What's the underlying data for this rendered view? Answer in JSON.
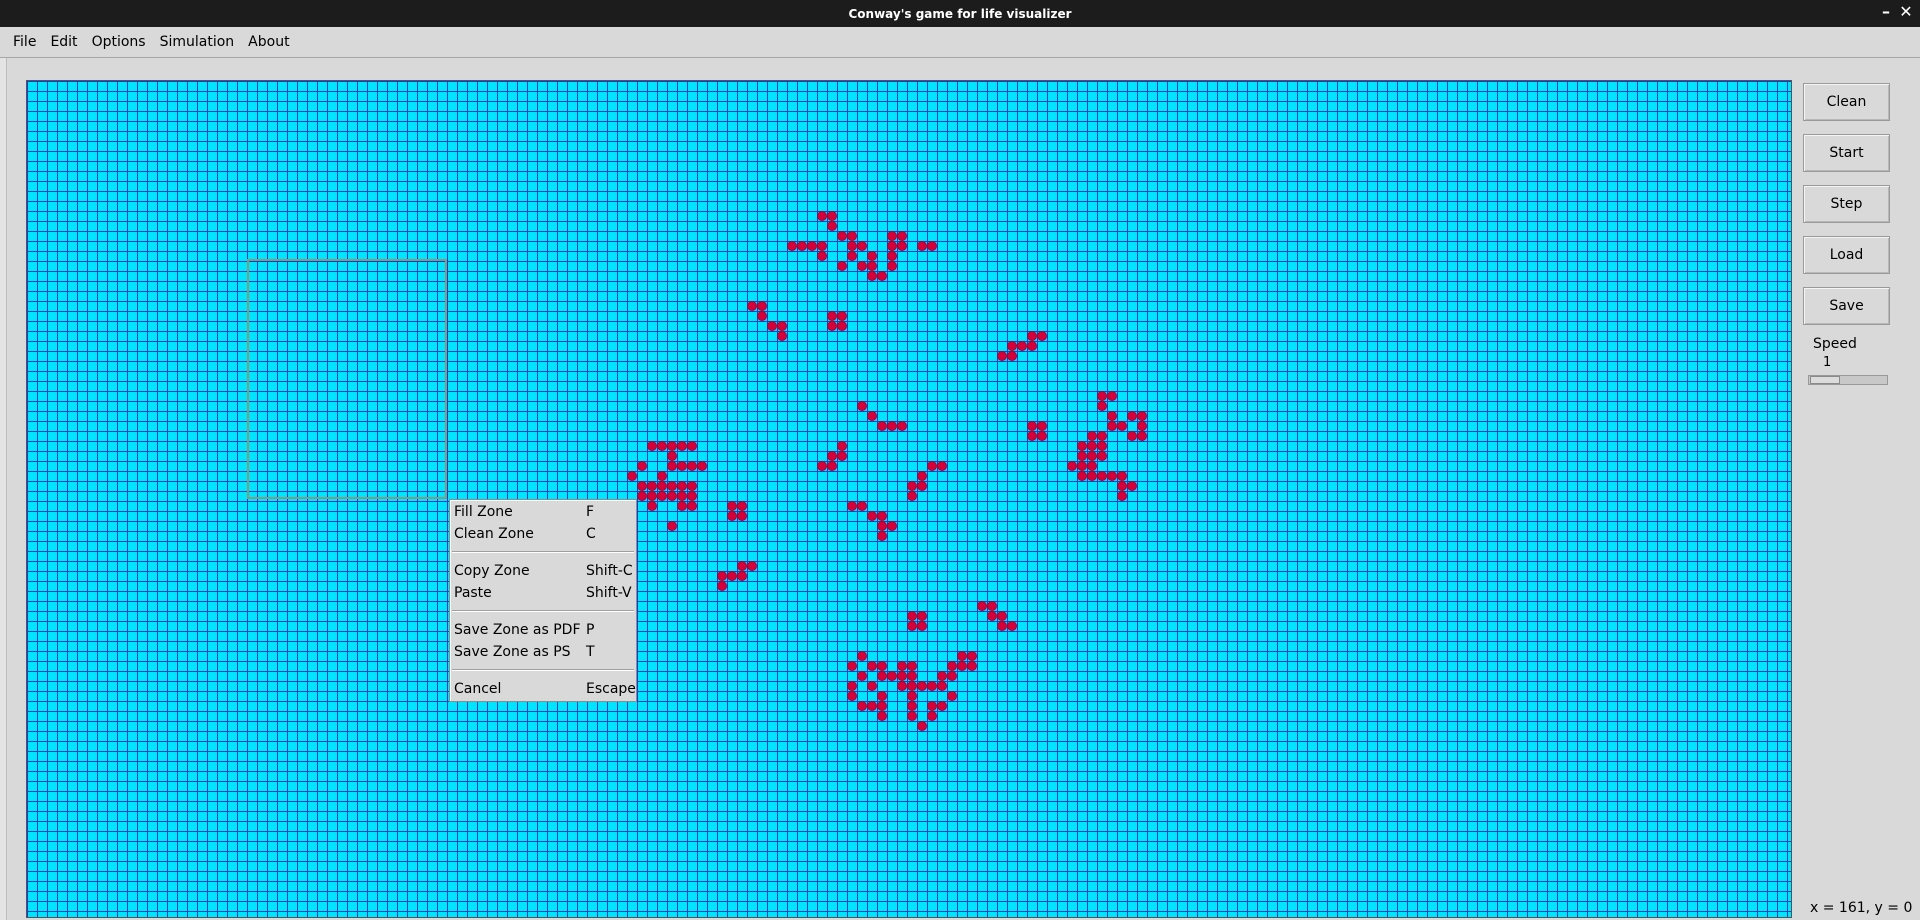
{
  "window": {
    "title": "Conway's game for life visualizer",
    "minimize_symbol": "–",
    "close_symbol": "✕"
  },
  "menubar": {
    "items": [
      "File",
      "Edit",
      "Options",
      "Simulation",
      "About"
    ]
  },
  "grid": {
    "background": "#00e5ff",
    "line_color": "#1540c8",
    "cell_color": "#d4003b",
    "live_cells": [
      [
        79,
        13
      ],
      [
        80,
        13
      ],
      [
        80,
        14
      ],
      [
        81,
        15
      ],
      [
        76,
        16
      ],
      [
        77,
        16
      ],
      [
        78,
        16
      ],
      [
        79,
        16
      ],
      [
        82,
        15
      ],
      [
        82,
        16
      ],
      [
        83,
        16
      ],
      [
        86,
        15
      ],
      [
        87,
        15
      ],
      [
        86,
        16
      ],
      [
        87,
        16
      ],
      [
        89,
        16
      ],
      [
        90,
        16
      ],
      [
        79,
        17
      ],
      [
        82,
        17
      ],
      [
        84,
        17
      ],
      [
        86,
        17
      ],
      [
        81,
        18
      ],
      [
        83,
        18
      ],
      [
        84,
        18
      ],
      [
        86,
        18
      ],
      [
        84,
        19
      ],
      [
        85,
        19
      ],
      [
        72,
        22
      ],
      [
        73,
        22
      ],
      [
        73,
        23
      ],
      [
        74,
        24
      ],
      [
        75,
        24
      ],
      [
        75,
        25
      ],
      [
        80,
        23
      ],
      [
        81,
        23
      ],
      [
        80,
        24
      ],
      [
        81,
        24
      ],
      [
        100,
        25
      ],
      [
        101,
        25
      ],
      [
        98,
        26
      ],
      [
        99,
        26
      ],
      [
        100,
        26
      ],
      [
        97,
        27
      ],
      [
        98,
        27
      ],
      [
        107,
        31
      ],
      [
        108,
        31
      ],
      [
        107,
        32
      ],
      [
        108,
        33
      ],
      [
        110,
        33
      ],
      [
        111,
        33
      ],
      [
        108,
        34
      ],
      [
        109,
        34
      ],
      [
        111,
        34
      ],
      [
        110,
        35
      ],
      [
        111,
        35
      ],
      [
        106,
        35
      ],
      [
        107,
        35
      ],
      [
        105,
        36
      ],
      [
        106,
        36
      ],
      [
        107,
        36
      ],
      [
        105,
        37
      ],
      [
        106,
        37
      ],
      [
        107,
        37
      ],
      [
        104,
        38
      ],
      [
        105,
        38
      ],
      [
        106,
        38
      ],
      [
        105,
        39
      ],
      [
        106,
        39
      ],
      [
        107,
        39
      ],
      [
        108,
        39
      ],
      [
        109,
        39
      ],
      [
        109,
        40
      ],
      [
        110,
        40
      ],
      [
        109,
        41
      ],
      [
        83,
        32
      ],
      [
        84,
        33
      ],
      [
        85,
        34
      ],
      [
        86,
        34
      ],
      [
        87,
        34
      ],
      [
        100,
        34
      ],
      [
        101,
        34
      ],
      [
        100,
        35
      ],
      [
        101,
        35
      ],
      [
        62,
        36
      ],
      [
        63,
        36
      ],
      [
        64,
        36
      ],
      [
        65,
        36
      ],
      [
        66,
        36
      ],
      [
        64,
        37
      ],
      [
        61,
        38
      ],
      [
        64,
        38
      ],
      [
        65,
        38
      ],
      [
        66,
        38
      ],
      [
        60,
        39
      ],
      [
        63,
        39
      ],
      [
        67,
        38
      ],
      [
        61,
        40
      ],
      [
        62,
        40
      ],
      [
        63,
        40
      ],
      [
        64,
        40
      ],
      [
        65,
        40
      ],
      [
        66,
        40
      ],
      [
        61,
        41
      ],
      [
        62,
        41
      ],
      [
        63,
        41
      ],
      [
        64,
        41
      ],
      [
        65,
        41
      ],
      [
        66,
        41
      ],
      [
        62,
        42
      ],
      [
        65,
        42
      ],
      [
        66,
        42
      ],
      [
        64,
        44
      ],
      [
        81,
        36
      ],
      [
        80,
        37
      ],
      [
        81,
        37
      ],
      [
        79,
        38
      ],
      [
        80,
        38
      ],
      [
        90,
        38
      ],
      [
        91,
        38
      ],
      [
        89,
        39
      ],
      [
        88,
        40
      ],
      [
        89,
        40
      ],
      [
        88,
        41
      ],
      [
        70,
        42
      ],
      [
        71,
        42
      ],
      [
        70,
        43
      ],
      [
        71,
        43
      ],
      [
        82,
        42
      ],
      [
        83,
        42
      ],
      [
        84,
        43
      ],
      [
        85,
        43
      ],
      [
        85,
        44
      ],
      [
        86,
        44
      ],
      [
        85,
        45
      ],
      [
        71,
        48
      ],
      [
        72,
        48
      ],
      [
        69,
        49
      ],
      [
        70,
        49
      ],
      [
        71,
        49
      ],
      [
        69,
        50
      ],
      [
        88,
        53
      ],
      [
        89,
        53
      ],
      [
        88,
        54
      ],
      [
        89,
        54
      ],
      [
        95,
        52
      ],
      [
        96,
        52
      ],
      [
        96,
        53
      ],
      [
        97,
        53
      ],
      [
        97,
        54
      ],
      [
        98,
        54
      ],
      [
        83,
        57
      ],
      [
        93,
        57
      ],
      [
        94,
        57
      ],
      [
        82,
        58
      ],
      [
        84,
        58
      ],
      [
        85,
        58
      ],
      [
        87,
        58
      ],
      [
        88,
        58
      ],
      [
        92,
        58
      ],
      [
        93,
        58
      ],
      [
        94,
        58
      ],
      [
        83,
        59
      ],
      [
        85,
        59
      ],
      [
        86,
        59
      ],
      [
        87,
        59
      ],
      [
        88,
        59
      ],
      [
        91,
        59
      ],
      [
        92,
        59
      ],
      [
        82,
        60
      ],
      [
        84,
        60
      ],
      [
        87,
        60
      ],
      [
        88,
        60
      ],
      [
        89,
        60
      ],
      [
        90,
        60
      ],
      [
        91,
        60
      ],
      [
        82,
        61
      ],
      [
        85,
        61
      ],
      [
        88,
        61
      ],
      [
        92,
        61
      ],
      [
        83,
        62
      ],
      [
        84,
        62
      ],
      [
        85,
        62
      ],
      [
        88,
        62
      ],
      [
        90,
        62
      ],
      [
        91,
        62
      ],
      [
        85,
        63
      ],
      [
        88,
        63
      ],
      [
        90,
        63
      ],
      [
        89,
        64
      ]
    ]
  },
  "context_menu": {
    "groups": [
      [
        {
          "label": "Fill Zone",
          "accel": "F"
        },
        {
          "label": "Clean Zone",
          "accel": "C"
        }
      ],
      [
        {
          "label": "Copy Zone",
          "accel": "Shift-C"
        },
        {
          "label": "Paste",
          "accel": "Shift-V"
        }
      ],
      [
        {
          "label": "Save Zone as PDF",
          "accel": "P"
        },
        {
          "label": "Save Zone as PS",
          "accel": "T"
        }
      ],
      [
        {
          "label": "Cancel",
          "accel": "Escape"
        }
      ]
    ]
  },
  "side_panel": {
    "buttons": [
      "Clean",
      "Start",
      "Step",
      "Load",
      "Save"
    ],
    "speed_label": "Speed",
    "speed_value": "1"
  },
  "status": {
    "coords": "x = 161, y = 0"
  }
}
